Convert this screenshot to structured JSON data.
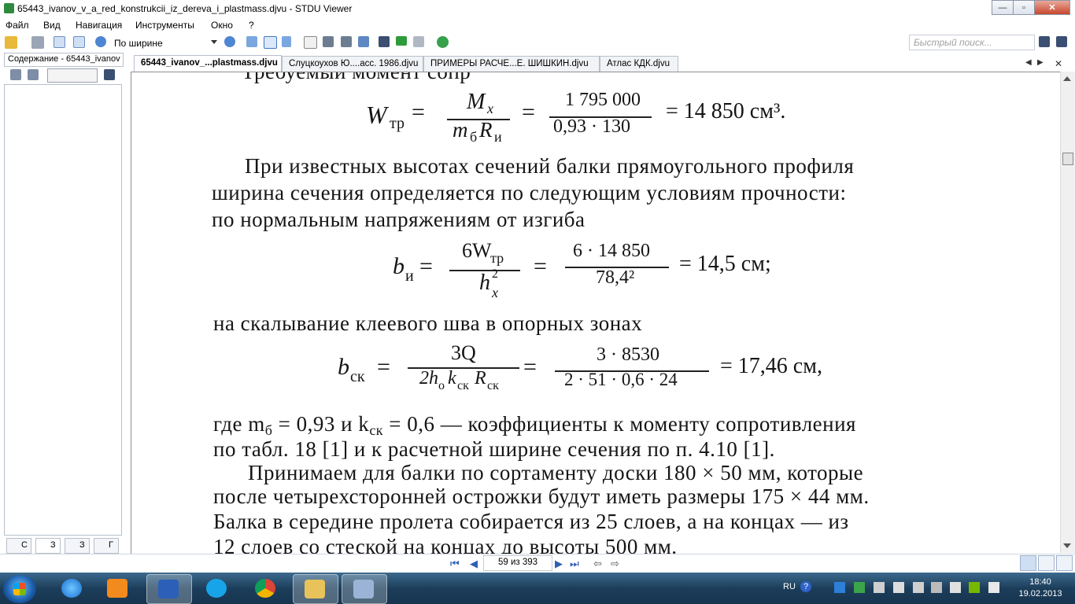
{
  "window": {
    "title": "65443_ivanov_v_a_red_konstrukcii_iz_dereva_i_plastmass.djvu - STDU Viewer",
    "controls": {
      "minimize": "—",
      "maximize": "▫",
      "close": "✕"
    }
  },
  "menu": [
    "Файл",
    "Вид",
    "Навигация",
    "Инструменты",
    "Окно",
    "?"
  ],
  "toolbar": {
    "zoom_value": "По ширине",
    "search_placeholder": "Быстрый поиск..."
  },
  "sidebar": {
    "tab_label": "Содержание - 65443_ivanov",
    "bottom_tabs": [
      "С",
      "З",
      "З",
      "Г"
    ]
  },
  "doc_tabs": [
    {
      "label": "65443_ivanov_...plastmass.djvu",
      "active": true
    },
    {
      "label": "Слуцкоухов Ю....асс. 1986.djvu",
      "active": false
    },
    {
      "label": "ПРИМЕРЫ РАСЧЕ...Е. ШИШКИН.djvu",
      "active": false
    },
    {
      "label": "Атлас КДК.djvu",
      "active": false
    }
  ],
  "page": {
    "top_partial": "Требуемый момент сопр",
    "eq1": {
      "lhs": "W",
      "lhs_sub": "тр",
      "num1": "M",
      "num1_sub": "x",
      "den1": "m",
      "den1_sub": "б",
      "den1b": "R",
      "den1b_sub": "и",
      "num2": "1 795 000",
      "den2": "0,93 · 130",
      "result": "= 14 850 см³."
    },
    "p1_l1": "При известных высотах сечений балки прямоугольного профиля",
    "p1_l2": "ширина сечения определяется по следующим условиям прочности:",
    "p1_l3": "по нормальным напряжениям от изгиба",
    "eq2": {
      "lhs": "b",
      "lhs_sub": "и",
      "num1": "6W",
      "num1_sub": "тр",
      "den1": "h",
      "den1_sup": "2",
      "den1_sub": "x",
      "num2": "6 · 14 850",
      "den2": "78,4²",
      "result": "= 14,5 см;"
    },
    "p2": "на скалывание клеевого шва в опорных зонах",
    "eq3": {
      "lhs": "b",
      "lhs_sub": "ск",
      "num1": "3Q",
      "den1": "2h",
      "den1_sub": "о",
      "den1b": "k",
      "den1b_sub": "ск",
      "den1c": "R",
      "den1c_sub": "ск",
      "num2": "3 · 8530",
      "den2": "2 · 51 · 0,6 · 24",
      "result": "= 17,46 см,"
    },
    "p3_l1": "где m",
    "p3_l1_sub": "б",
    "p3_l1b": " = 0,93 и  k",
    "p3_l1b_sub": "ск",
    "p3_l1c": " = 0,6 — коэффициенты к моменту сопротивления",
    "p3_l2": "по табл. 18 [1] и к расчетной ширине сечения по п. 4.10 [1].",
    "p4_l1": "Принимаем для балки по сортаменту доски 180 × 50 мм, которые",
    "p4_l2": "после четырехсторонней острожки будут иметь размеры 175 × 44 мм.",
    "p4_l3": "Балка в середине пролета собирается из 25 слоев, а на концах — из",
    "p4_l4": "12 слоев со стеской на концах до высоты 500 мм."
  },
  "status": {
    "page_indicator": "59 из 393"
  },
  "taskbar": {
    "lang": "RU",
    "time": "18:40",
    "date": "19.02.2013"
  }
}
